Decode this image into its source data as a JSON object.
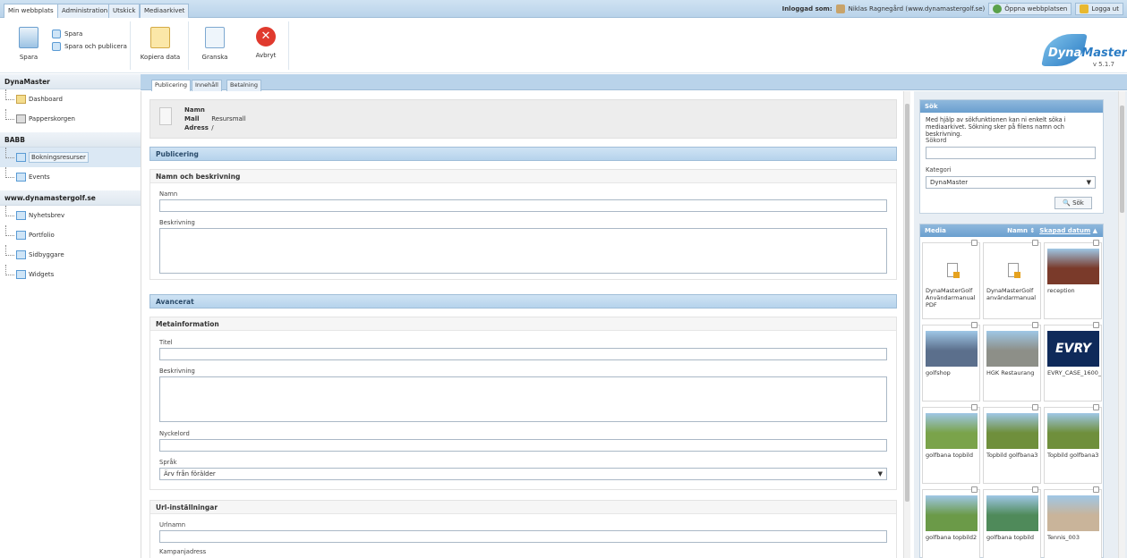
{
  "top_tabs": [
    "Min webbplats",
    "Administration",
    "Utskick",
    "Mediaarkivet"
  ],
  "header": {
    "logged_in_label": "Inloggad som:",
    "user": "Niklas Ragnegård (www.dynamastergolf.se)",
    "open_site": "Öppna webbplatsen",
    "logout": "Logga ut"
  },
  "toolbar": {
    "save": "Spara",
    "save_small": "Spara",
    "save_publish": "Spara och publicera",
    "copy": "Kopiera data",
    "review": "Granska",
    "cancel": "Avbryt"
  },
  "logo": {
    "dyna": "Dyna",
    "master": "Master",
    "version": "v 5.1.7"
  },
  "sidebar": {
    "sections": [
      {
        "title": "DynaMaster",
        "items": [
          "Dashboard",
          "Papperskorgen"
        ]
      },
      {
        "title": "BABB",
        "items": [
          "Bokningsresurser",
          "Events"
        ]
      },
      {
        "title": "www.dynamastergolf.se",
        "items": [
          "Nyhetsbrev",
          "Portfolio",
          "Sidbyggare",
          "Widgets"
        ]
      }
    ]
  },
  "content_tabs": [
    "Publicering",
    "Innehåll",
    "Betalning"
  ],
  "info": {
    "name_label": "Namn",
    "mall_label": "Mall",
    "mall_value": "Resursmall",
    "adress_label": "Adress",
    "adress_value": "/"
  },
  "form": {
    "publicering": "Publicering",
    "namn_beskrivning": "Namn och beskrivning",
    "namn": "Namn",
    "beskrivning": "Beskrivning",
    "avancerat": "Avancerat",
    "metainformation": "Metainformation",
    "titel": "Titel",
    "meta_beskrivning": "Beskrivning",
    "nyckelord": "Nyckelord",
    "sprak": "Språk",
    "sprak_value": "Ärv från förälder",
    "url_installningar": "Url-inställningar",
    "urlnamn": "Urlnamn",
    "kampanjadress": "Kampanjadress"
  },
  "search": {
    "title": "Sök",
    "help": "Med hjälp av sökfunktionen kan ni enkelt söka i mediaarkivet. Sökning sker på filens namn och beskrivning.",
    "sokord": "Sökord",
    "kategori": "Kategori",
    "kategori_value": "DynaMaster",
    "button": "Sök"
  },
  "media": {
    "title": "Media",
    "sort_name": "Namn",
    "sort_date": "Skapad datum",
    "items": [
      {
        "caption": "DynaMasterGolf Användarmanual PDF",
        "kind": "pdf"
      },
      {
        "caption": "DynaMasterGolf användarmanual",
        "kind": "pdf"
      },
      {
        "caption": "reception",
        "kind": "photo",
        "color": "#7a3a2a"
      },
      {
        "caption": "golfshop",
        "kind": "photo",
        "color": "#5b6f8c"
      },
      {
        "caption": "HGK Restaurang",
        "kind": "photo",
        "color": "#8d8f88"
      },
      {
        "caption": "EVRY_CASE_1600_",
        "kind": "evry",
        "color": "#0f2a5a"
      },
      {
        "caption": "golfbana topbild",
        "kind": "photo",
        "color": "#7aa34a"
      },
      {
        "caption": "Topbild golfbana3",
        "kind": "photo",
        "color": "#6f8f3c"
      },
      {
        "caption": "Topbild golfbana3",
        "kind": "photo",
        "color": "#6f8f3c"
      },
      {
        "caption": "golfbana topbild2",
        "kind": "photo",
        "color": "#6b9a48"
      },
      {
        "caption": "golfbana topbild",
        "kind": "photo",
        "color": "#4f8a5a"
      },
      {
        "caption": "Tennis_003",
        "kind": "photo",
        "color": "#c9b49a"
      }
    ]
  }
}
